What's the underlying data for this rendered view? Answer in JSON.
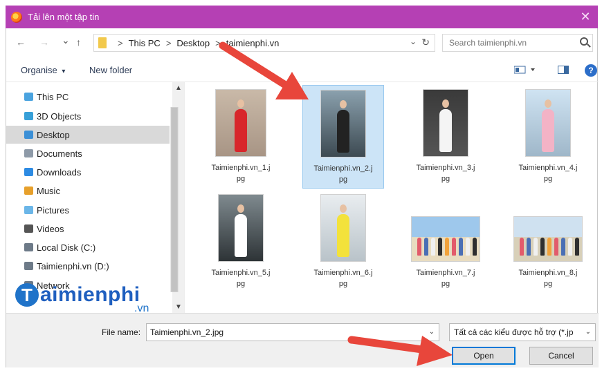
{
  "window": {
    "title": "Tải lên một tập tin",
    "close": "✕"
  },
  "nav": {
    "back": "←",
    "forward": "→",
    "recent": "⌄",
    "up": "↑"
  },
  "address": {
    "sep": ">",
    "crumbs": [
      "This PC",
      "Desktop",
      "taimienphi.vn"
    ],
    "dropdown": "⌄",
    "refresh": "↻"
  },
  "search": {
    "placeholder": "Search taimienphi.vn"
  },
  "toolbar": {
    "organise": "Organise",
    "organise_caret": "▾",
    "new_folder": "New folder",
    "help": "?"
  },
  "sidebar": {
    "items": [
      {
        "label": "This PC",
        "icon": "computer-icon",
        "color": "#4aa3df"
      },
      {
        "label": "3D Objects",
        "icon": "cube-icon",
        "color": "#38a0d8"
      },
      {
        "label": "Desktop",
        "icon": "desktop-icon",
        "color": "#3b8fd6",
        "selected": true
      },
      {
        "label": "Documents",
        "icon": "document-icon",
        "color": "#8e9aa8"
      },
      {
        "label": "Downloads",
        "icon": "download-icon",
        "color": "#2d8be3"
      },
      {
        "label": "Music",
        "icon": "music-icon",
        "color": "#e7a02b"
      },
      {
        "label": "Pictures",
        "icon": "pictures-icon",
        "color": "#6bb6e8"
      },
      {
        "label": "Videos",
        "icon": "video-icon",
        "color": "#555555"
      },
      {
        "label": "Local Disk (C:)",
        "icon": "drive-icon",
        "color": "#6d7a88"
      },
      {
        "label": "Taimienphi.vn (D:)",
        "icon": "drive-icon",
        "color": "#6d7a88"
      },
      {
        "label": "Network",
        "icon": "network-icon",
        "color": "#6d7a88"
      }
    ],
    "scroll_up": "▲",
    "scroll_down": "▼"
  },
  "logo": {
    "letter": "T",
    "word": "aimienphi",
    "tld": ".vn"
  },
  "files": [
    {
      "name_line1": "Taimienphi.vn_1.j",
      "name_line2": "pg"
    },
    {
      "name_line1": "Taimienphi.vn_2.j",
      "name_line2": "pg",
      "selected": true
    },
    {
      "name_line1": "Taimienphi.vn_3.j",
      "name_line2": "pg"
    },
    {
      "name_line1": "Taimienphi.vn_4.j",
      "name_line2": "pg"
    },
    {
      "name_line1": "Taimienphi.vn_5.j",
      "name_line2": "pg"
    },
    {
      "name_line1": "Taimienphi.vn_6.j",
      "name_line2": "pg"
    },
    {
      "name_line1": "Taimienphi.vn_7.j",
      "name_line2": "pg"
    },
    {
      "name_line1": "Taimienphi.vn_8.j",
      "name_line2": "pg"
    }
  ],
  "footer": {
    "file_name_label": "File name:",
    "file_name_value": "Taimienphi.vn_2.jpg",
    "filter": "Tất cả các kiểu được hỗ trợ (*.jp",
    "caret": "⌄",
    "open": "Open",
    "cancel": "Cancel"
  },
  "colors": {
    "titlebar": "#b540b4",
    "selection": "#cce4f7",
    "arrow": "#e8463b",
    "primary_border": "#0078d7"
  }
}
